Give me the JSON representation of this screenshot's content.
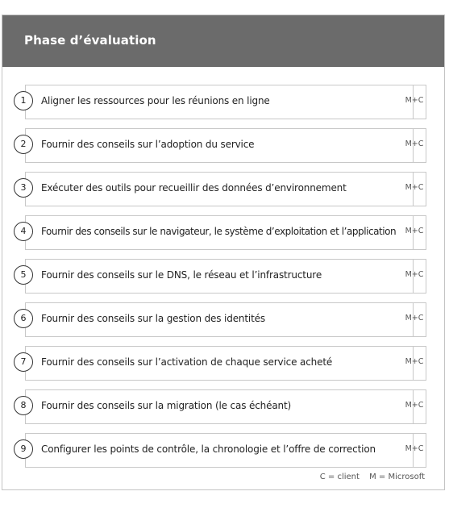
{
  "header": {
    "title": "Phase d’évaluation"
  },
  "steps": [
    {
      "number": "1",
      "label": "Aligner les ressources pour les réunions en ligne",
      "owner": "M+C"
    },
    {
      "number": "2",
      "label": "Fournir des conseils sur l’adoption du service",
      "owner": "M+C"
    },
    {
      "number": "3",
      "label": "Exécuter des outils pour recueillir des données d’environnement",
      "owner": "M+C"
    },
    {
      "number": "4",
      "label": "Fournir des conseils sur le navigateur, le système d’exploitation et l’application",
      "owner": "M+C"
    },
    {
      "number": "5",
      "label": "Fournir des conseils sur le DNS, le réseau et l’infrastructure",
      "owner": "M+C"
    },
    {
      "number": "6",
      "label": "Fournir des conseils sur la gestion des identités",
      "owner": "M+C"
    },
    {
      "number": "7",
      "label": "Fournir des conseils sur l’activation de chaque service acheté",
      "owner": "M+C"
    },
    {
      "number": "8",
      "label": "Fournir des conseils sur la migration (le cas échéant)",
      "owner": "M+C"
    },
    {
      "number": "9",
      "label": "Configurer les points de contrôle, la chronologie et l’offre de correction",
      "owner": "M+C"
    }
  ],
  "legend": {
    "client": "C = client",
    "microsoft": "M = Microsoft"
  }
}
